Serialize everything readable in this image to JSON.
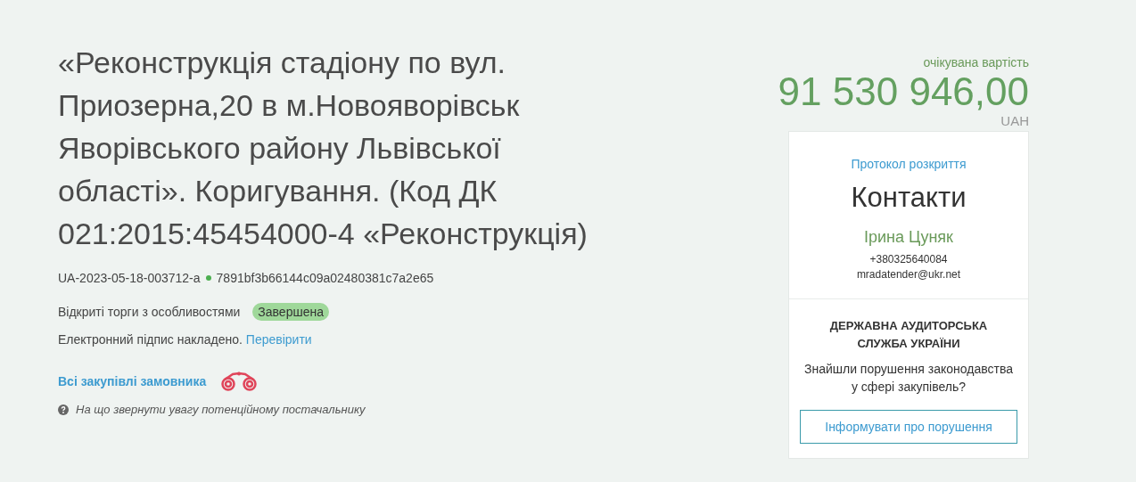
{
  "title": "«Реконструкція стадіону по вул. Приозерна,20 в м.Новояворівськ Яворівського району Львівської області». Коригування. (Код ДК 021:2015:45454000-4 «Реконструкція)",
  "tender_id": "UA-2023-05-18-003712-a",
  "hash": "7891bf3b66144c09a02480381c7a2e65",
  "procedure": "Відкриті торги з особливостями",
  "status": "Завершена",
  "signature_text": "Електронний підпис накладено.",
  "signature_link": "Перевірити",
  "customer_link": "Всі закупівлі замовника",
  "hint": "На що звернути увагу потенційному постачальнику",
  "expected_label": "очікувана вартість",
  "amount": "91 530 946,00",
  "currency": "UAH",
  "contacts": {
    "protocol_link": "Протокол розкриття",
    "heading": "Контакти",
    "name": "Ірина Цуняк",
    "phone": "+380325640084",
    "email": "mradatender@ukr.net"
  },
  "audit": {
    "heading": "ДЕРЖАВНА АУДИТОРСЬКА СЛУЖБА УКРАЇНИ",
    "question": "Знайшли порушення законодавства у сфері закупівель?",
    "button": "Інформувати про порушення"
  }
}
